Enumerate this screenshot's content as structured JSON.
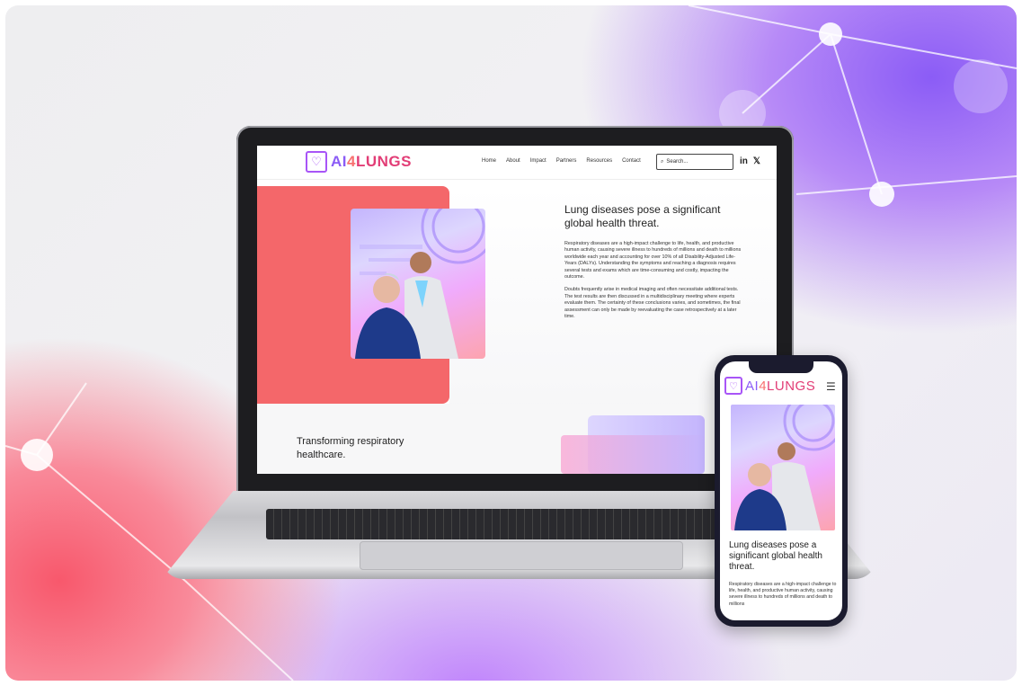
{
  "desktop": {
    "logo": {
      "part1": "AI",
      "part2": "4",
      "part3": "LUNGS"
    },
    "nav": [
      "Home",
      "About",
      "Impact",
      "Partners",
      "Resources",
      "Contact"
    ],
    "search_placeholder": "Search...",
    "social": {
      "linkedin": "in",
      "x": "𝕏"
    },
    "hero_title": "Lung diseases pose a significant global health threat.",
    "paragraph1": "Respiratory diseases are a high-impact challenge to life, health, and productive human activity, causing severe illness to hundreds of millions and death to millions worldwide each year and accounting for over 10% of all Disability-Adjusted Life-Years (DALYs). Understanding the symptoms and reaching a diagnosis requires several tests and exams which are time-consuming and costly, impacting the outcome.",
    "paragraph2": "Doubts frequently arise in medical imaging and often necessitate additional tests. The test results are then discussed in a multidisciplinary meeting where experts evaluate them. The certainty of these conclusions varies, and sometimes, the final assessment can only be made by reevaluating the case retrospectively at a later time.",
    "section_title": "Transforming respiratory healthcare."
  },
  "mobile": {
    "logo": {
      "part1": "AI",
      "part2": "4",
      "part3": "LUNGS"
    },
    "menu_icon": "hamburger-icon",
    "hero_title": "Lung diseases pose a significant global health threat.",
    "paragraph": "Respiratory diseases are a high-impact challenge to life, health, and productive human activity, causing severe illness to hundreds of millions and death to millions"
  },
  "colors": {
    "coral": "#f4676a",
    "purple": "#8b5cf6",
    "pink": "#e23d76"
  }
}
